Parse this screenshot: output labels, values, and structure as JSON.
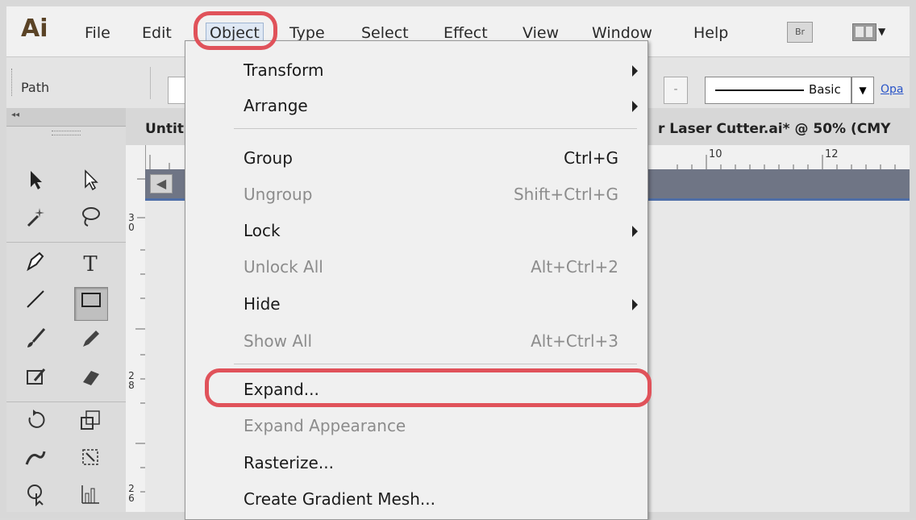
{
  "app": {
    "logo": "Ai"
  },
  "menubar": {
    "items": [
      "File",
      "Edit",
      "Object",
      "Type",
      "Select",
      "Effect",
      "View",
      "Window",
      "Help"
    ],
    "active": "Object",
    "bridge_button": "Br"
  },
  "controlbar": {
    "selection_label": "Path",
    "stroke_profile": "Basic",
    "opacity_link": "Opa"
  },
  "document": {
    "tab_title_left": "Untitl",
    "tab_title_right": "r Laser Cutter.ai* @ 50% (CMY",
    "ruler_top_numbers": [
      "10",
      "12"
    ],
    "ruler_left_numbers": [
      [
        "3",
        "0"
      ],
      [
        "2",
        "8"
      ],
      [
        "2",
        "6"
      ]
    ]
  },
  "object_menu": {
    "items": [
      {
        "label": "Transform",
        "shortcut": "",
        "submenu": true,
        "enabled": true
      },
      {
        "label": "Arrange",
        "shortcut": "",
        "submenu": true,
        "enabled": true
      },
      {
        "label": "Group",
        "shortcut": "Ctrl+G",
        "submenu": false,
        "enabled": true
      },
      {
        "label": "Ungroup",
        "shortcut": "Shift+Ctrl+G",
        "submenu": false,
        "enabled": false
      },
      {
        "label": "Lock",
        "shortcut": "",
        "submenu": true,
        "enabled": true
      },
      {
        "label": "Unlock All",
        "shortcut": "Alt+Ctrl+2",
        "submenu": false,
        "enabled": false
      },
      {
        "label": "Hide",
        "shortcut": "",
        "submenu": true,
        "enabled": true
      },
      {
        "label": "Show All",
        "shortcut": "Alt+Ctrl+3",
        "submenu": false,
        "enabled": false
      },
      {
        "label": "Expand...",
        "shortcut": "",
        "submenu": false,
        "enabled": true,
        "highlighted": true
      },
      {
        "label": "Expand Appearance",
        "shortcut": "",
        "submenu": false,
        "enabled": false
      },
      {
        "label": "Rasterize...",
        "shortcut": "",
        "submenu": false,
        "enabled": true
      },
      {
        "label": "Create Gradient Mesh...",
        "shortcut": "",
        "submenu": false,
        "enabled": true
      }
    ]
  },
  "tools": [
    "selection-tool-icon",
    "direct-selection-tool-icon",
    "magic-wand-tool-icon",
    "lasso-tool-icon",
    "pen-tool-icon",
    "type-tool-icon",
    "line-segment-tool-icon",
    "rectangle-tool-icon",
    "paintbrush-tool-icon",
    "pencil-tool-icon",
    "blob-brush-tool-icon",
    "eraser-tool-icon",
    "rotate-tool-icon",
    "scale-tool-icon",
    "warp-tool-icon",
    "free-transform-tool-icon",
    "shape-builder-tool-icon",
    "graph-tool-icon"
  ],
  "highlight_color": "#e0525a"
}
